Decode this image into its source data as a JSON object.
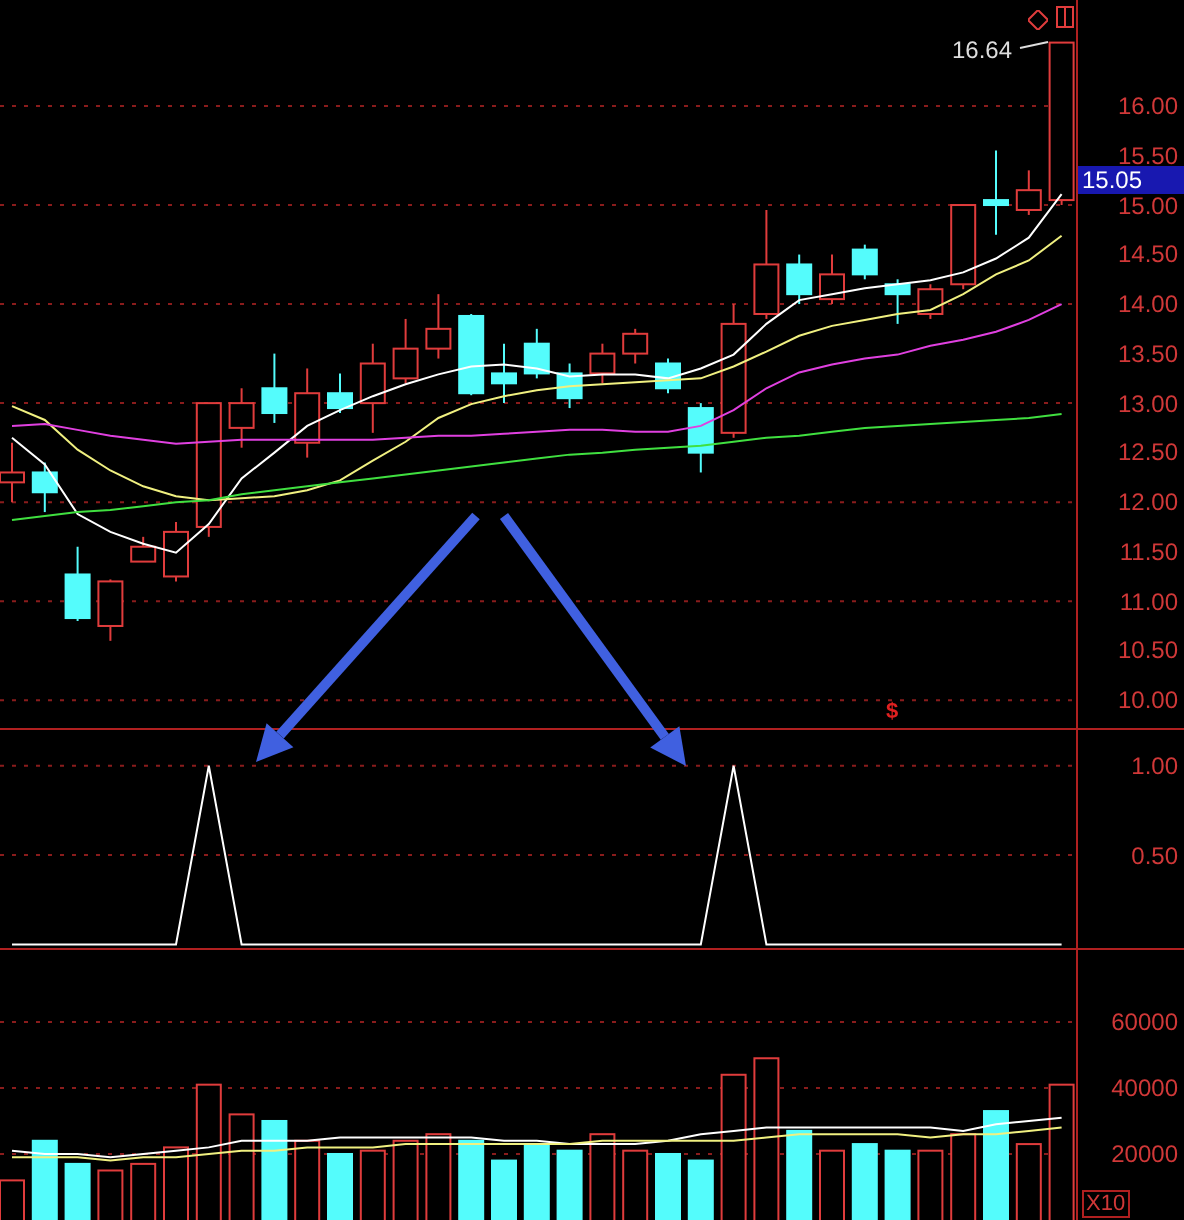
{
  "price_panel": {
    "high_label": "16.64",
    "marker": "$",
    "current_price": "15.05",
    "candles": {
      "chart_data": {
        "type": "candlestick",
        "grid": true,
        "ylim": [
          9.72,
          17.07
        ],
        "yticks": [
          {
            "value": 16,
            "label": "16.00"
          },
          {
            "value": 15.5,
            "label": "15.50"
          },
          {
            "value": 15,
            "label": "15.00"
          },
          {
            "value": 14.5,
            "label": "14.50"
          },
          {
            "value": 14,
            "label": "14.00"
          },
          {
            "value": 13.5,
            "label": "13.50"
          },
          {
            "value": 13,
            "label": "13.00"
          },
          {
            "value": 12.5,
            "label": "12.50"
          },
          {
            "value": 12,
            "label": "12.00"
          },
          {
            "value": 11.5,
            "label": "11.50"
          },
          {
            "value": 11,
            "label": "11.00"
          },
          {
            "value": 10.5,
            "label": "10.50"
          },
          {
            "value": 10,
            "label": "10.00"
          }
        ],
        "ohlc": [
          [
            12.2,
            12.6,
            12.0,
            12.3
          ],
          [
            12.3,
            12.4,
            11.9,
            12.1
          ],
          [
            11.27,
            11.55,
            10.8,
            10.83
          ],
          [
            10.75,
            11.22,
            10.6,
            11.2
          ],
          [
            11.4,
            11.65,
            11.4,
            11.55
          ],
          [
            11.25,
            11.8,
            11.2,
            11.7
          ],
          [
            11.75,
            13.0,
            11.65,
            13.0
          ],
          [
            12.75,
            13.15,
            12.55,
            13.0
          ],
          [
            13.15,
            13.5,
            12.8,
            12.9
          ],
          [
            12.6,
            13.35,
            12.45,
            13.1
          ],
          [
            13.1,
            13.3,
            12.9,
            12.95
          ],
          [
            13.0,
            13.6,
            12.7,
            13.4
          ],
          [
            13.25,
            13.85,
            13.2,
            13.55
          ],
          [
            13.55,
            14.1,
            13.45,
            13.75
          ],
          [
            13.88,
            13.9,
            13.08,
            13.1
          ],
          [
            13.3,
            13.6,
            13.0,
            13.2
          ],
          [
            13.6,
            13.75,
            13.25,
            13.3
          ],
          [
            13.3,
            13.4,
            12.95,
            13.05
          ],
          [
            13.3,
            13.6,
            13.2,
            13.5
          ],
          [
            13.5,
            13.75,
            13.4,
            13.7
          ],
          [
            13.4,
            13.45,
            13.1,
            13.15
          ],
          [
            12.95,
            13.0,
            12.3,
            12.5
          ],
          [
            12.7,
            14.0,
            12.65,
            13.8
          ],
          [
            13.9,
            14.95,
            13.85,
            14.4
          ],
          [
            14.4,
            14.5,
            14.0,
            14.1
          ],
          [
            14.05,
            14.5,
            14.0,
            14.3
          ],
          [
            14.55,
            14.6,
            14.25,
            14.3
          ],
          [
            14.2,
            14.25,
            13.8,
            14.1
          ],
          [
            13.9,
            14.2,
            13.85,
            14.15
          ],
          [
            14.2,
            15.0,
            14.15,
            15.0
          ],
          [
            15.05,
            15.55,
            14.7,
            15.0
          ],
          [
            14.95,
            15.35,
            14.9,
            15.15
          ],
          [
            15.05,
            16.64,
            15.0,
            16.64
          ]
        ],
        "series": [
          {
            "type": "line",
            "color": "#ffffff",
            "values": [
              12.65,
              12.38,
              11.88,
              11.7,
              11.58,
              11.49,
              11.78,
              12.24,
              12.5,
              12.77,
              12.93,
              13.07,
              13.19,
              13.29,
              13.37,
              13.39,
              13.35,
              13.27,
              13.29,
              13.29,
              13.25,
              13.35,
              13.49,
              13.8,
              14.04,
              14.1,
              14.16,
              14.2,
              14.24,
              14.32,
              14.46,
              14.67,
              15.11
            ]
          },
          {
            "type": "line",
            "color": "#f0f080",
            "values": [
              12.97,
              12.83,
              12.53,
              12.32,
              12.16,
              12.06,
              12.02,
              12.04,
              12.06,
              12.12,
              12.22,
              12.42,
              12.61,
              12.85,
              12.99,
              13.07,
              13.13,
              13.17,
              13.19,
              13.21,
              13.23,
              13.25,
              13.37,
              13.52,
              13.68,
              13.78,
              13.84,
              13.9,
              13.94,
              14.1,
              14.3,
              14.44,
              14.69
            ]
          },
          {
            "type": "line",
            "color": "#e040e0",
            "values": [
              12.77,
              12.79,
              12.73,
              12.67,
              12.63,
              12.59,
              12.61,
              12.63,
              12.63,
              12.63,
              12.63,
              12.63,
              12.65,
              12.67,
              12.67,
              12.69,
              12.71,
              12.73,
              12.73,
              12.71,
              12.71,
              12.77,
              12.93,
              13.15,
              13.31,
              13.39,
              13.45,
              13.49,
              13.58,
              13.64,
              13.72,
              13.84,
              14.0
            ]
          },
          {
            "type": "line",
            "color": "#40e040",
            "values": [
              11.82,
              11.86,
              11.9,
              11.92,
              11.96,
              12.0,
              12.02,
              12.08,
              12.12,
              12.16,
              12.2,
              12.24,
              12.28,
              12.32,
              12.36,
              12.4,
              12.44,
              12.48,
              12.5,
              12.53,
              12.55,
              12.57,
              12.61,
              12.65,
              12.67,
              12.71,
              12.75,
              12.77,
              12.79,
              12.81,
              12.83,
              12.85,
              12.89
            ]
          }
        ]
      }
    }
  },
  "indicator_panel": {
    "chart_data": {
      "type": "line",
      "grid": true,
      "ylim": [
        -0.02,
        1.2
      ],
      "yticks": [
        {
          "value": 1,
          "label": "1.00"
        },
        {
          "value": 0.5,
          "label": "0.50"
        }
      ],
      "series": [
        {
          "color": "#ffffff",
          "values": [
            0,
            0,
            0,
            0,
            0,
            0,
            1,
            0,
            0,
            0,
            0,
            0,
            0,
            0,
            0,
            0,
            0,
            0,
            0,
            0,
            0,
            0,
            1,
            0,
            0,
            0,
            0,
            0,
            0,
            0,
            0,
            0,
            0
          ]
        }
      ]
    }
  },
  "volume_panel": {
    "unit": "X10",
    "bars": {
      "chart_data": {
        "type": "bar",
        "grid": true,
        "ylim": [
          0,
          81800
        ],
        "yticks": [
          {
            "value": 60000,
            "label": "60000"
          },
          {
            "value": 40000,
            "label": "40000"
          },
          {
            "value": 20000,
            "label": "20000"
          }
        ],
        "series": [
          {
            "color": "#e03c3c",
            "values": [
              12000,
              null,
              null,
              15000,
              17000,
              22000,
              41000,
              32000,
              null,
              24000,
              null,
              21000,
              24000,
              26000,
              null,
              null,
              null,
              null,
              26000,
              21000,
              null,
              null,
              44000,
              49000,
              null,
              21000,
              null,
              null,
              21000,
              26000,
              null,
              23000,
              41000
            ]
          },
          {
            "color": "#54fcfc",
            "values": [
              null,
              24000,
              17000,
              null,
              null,
              null,
              null,
              null,
              30000,
              null,
              20000,
              null,
              null,
              null,
              24000,
              18000,
              23000,
              21000,
              null,
              null,
              20000,
              18000,
              null,
              null,
              27000,
              null,
              23000,
              21000,
              null,
              null,
              33000,
              null,
              null
            ]
          },
          {
            "type": "line",
            "color": "#ffffff",
            "values": [
              21000,
              20000,
              20000,
              19000,
              20000,
              21000,
              22000,
              24000,
              24000,
              24000,
              25000,
              25000,
              25000,
              25000,
              25000,
              24000,
              24000,
              23000,
              23000,
              23000,
              24000,
              26000,
              27000,
              28000,
              28000,
              28000,
              28000,
              28000,
              28000,
              27000,
              29000,
              30000,
              31000
            ]
          },
          {
            "type": "line",
            "color": "#f0f080",
            "values": [
              19000,
              19000,
              19000,
              18000,
              19000,
              19000,
              20000,
              21000,
              21000,
              22000,
              22000,
              22000,
              23000,
              23000,
              23000,
              23000,
              23000,
              23000,
              24000,
              24000,
              24000,
              24000,
              24000,
              25000,
              26000,
              26000,
              26000,
              26000,
              25000,
              26000,
              26000,
              27000,
              28000
            ]
          }
        ]
      }
    }
  }
}
